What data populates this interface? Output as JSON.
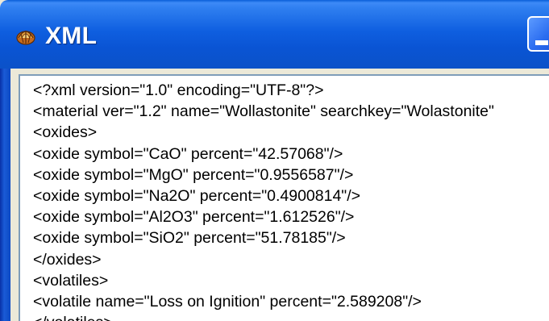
{
  "window": {
    "title": "XML",
    "icon": "app-logo-icon",
    "button_icon": "minimize-icon"
  },
  "xml_text": {
    "lines": [
      "<?xml version=\"1.0\" encoding=\"UTF-8\"?>",
      "<material ver=\"1.2\" name=\"Wollastonite\" searchkey=\"Wolastonite\"",
      "<oxides>",
      "<oxide symbol=\"CaO\" percent=\"42.57068\"/>",
      "<oxide symbol=\"MgO\" percent=\"0.9556587\"/>",
      "<oxide symbol=\"Na2O\" percent=\"0.4900814\"/>",
      "<oxide symbol=\"Al2O3\" percent=\"1.612526\"/>",
      "<oxide symbol=\"SiO2\" percent=\"51.78185\"/>",
      "</oxides>",
      "<volatiles>",
      "<volatile name=\"Loss on Ignition\" percent=\"2.589208\"/>",
      "</volatiles>"
    ]
  },
  "colors": {
    "titlebar": "#0a54d4",
    "frame": "#0831a8",
    "client_background": "#ece9d8",
    "text_background": "#ffffff",
    "text_border": "#7f9db9"
  }
}
